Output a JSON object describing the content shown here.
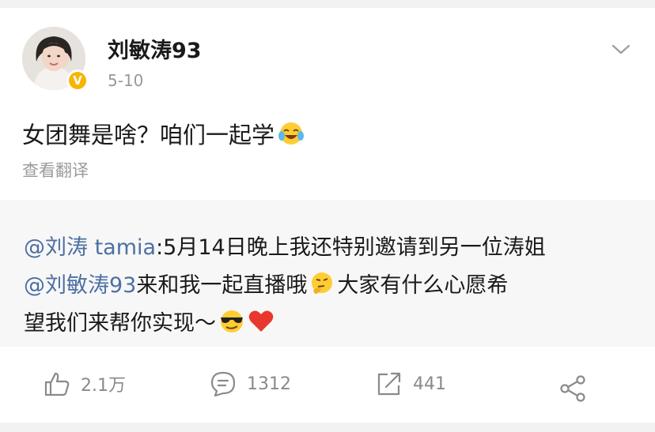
{
  "post": {
    "author": "刘敏涛93",
    "verified_badge": "V",
    "time": "5-10",
    "text": "女团舞是啥？咱们一起学",
    "text_emoji": "laugh-cry-emoji",
    "translate_link": "查看翻译"
  },
  "repost": {
    "mention1": "@刘涛 tamia",
    "line1_rest": ":5月14日晚上我还特别邀请到另一位涛姐",
    "mention2": "@刘敏涛93",
    "line2_rest_a": " 来和我一起直播哦",
    "line2_emoji": "thinking-emoji",
    "line2_rest_b": "大家有什么心愿希",
    "line3_text": "望我们来帮你实现～",
    "line3_emojis": [
      "sunglasses-emoji",
      "red-heart-emoji"
    ]
  },
  "actions": {
    "like_count": "2.1万",
    "comment_count": "1312",
    "repost_count": "441"
  },
  "colors": {
    "mention": "#4d6fa3",
    "badge": "#f7b500",
    "muted_text": "#8a8a8a",
    "repost_bg": "#f7f7f7"
  }
}
